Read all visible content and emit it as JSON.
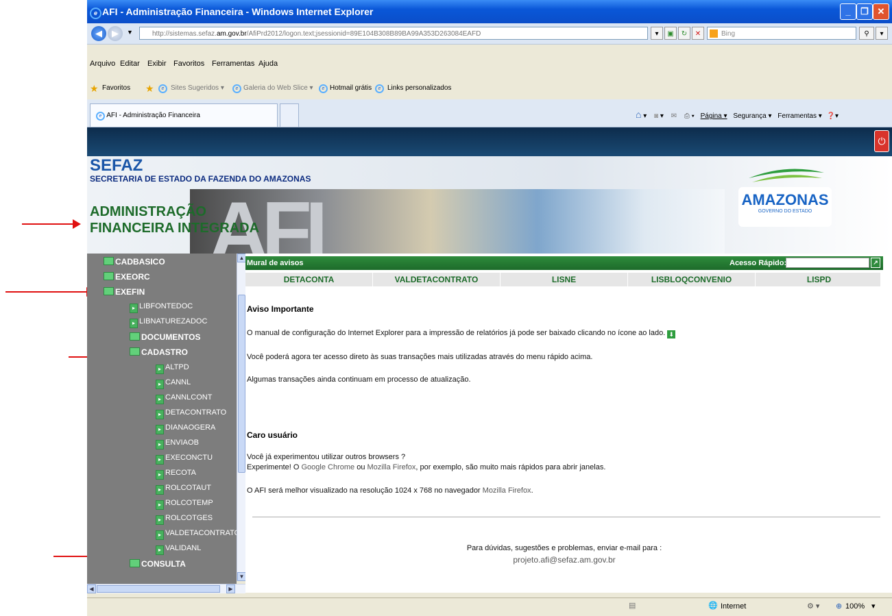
{
  "browser": {
    "title": "AFI - Administração Financeira - Windows Internet Explorer",
    "url_prefix": "http://sistemas.sefaz.",
    "url_domain": "am.gov.br",
    "url_path": "/AfiPrd2012/logon.text;jsessionid=89E104B308B89BA99A353D263084EAFD",
    "search_placeholder": "Bing",
    "menu": [
      "Arquivo",
      "Editar",
      "Exibir",
      "Favoritos",
      "Ferramentas",
      "Ajuda"
    ],
    "favorites_label": "Favoritos",
    "favorites": [
      "Sites Sugeridos ▾",
      "Galeria do Web Slice ▾",
      "Hotmail grátis",
      "Links personalizados"
    ],
    "tab_label": "AFI - Administração Financeira",
    "commands": [
      "Página ▾",
      "Segurança ▾",
      "Ferramentas ▾"
    ],
    "status_zone": "Internet",
    "zoom": "100%"
  },
  "banner": {
    "sefaz": "SEFAZ",
    "sefaz_sub": "SECRETARIA DE ESTADO DA FAZENDA DO AMAZONAS",
    "adm_line1": "ADMINISTRAÇÃO",
    "adm_line2": "FINANCEIRA INTEGRADA",
    "logo_main": "AMAZONAS",
    "logo_sub": "GOVERNO DO ESTADO"
  },
  "sidebar": {
    "items": [
      {
        "label": "CADBASICO"
      },
      {
        "label": "EXEORC"
      },
      {
        "label": "EXEFIN"
      },
      {
        "label": "LIBFONTEDOC"
      },
      {
        "label": "LIBNATUREZADOC"
      },
      {
        "label": "DOCUMENTOS"
      },
      {
        "label": "CADASTRO"
      },
      {
        "label": "ALTPD"
      },
      {
        "label": "CANNL"
      },
      {
        "label": "CANNLCONT"
      },
      {
        "label": "DETACONTRATO"
      },
      {
        "label": "DIANAOGERA"
      },
      {
        "label": "ENVIAOB"
      },
      {
        "label": "EXECONCTU"
      },
      {
        "label": "RECOTA"
      },
      {
        "label": "ROLCOTAUT"
      },
      {
        "label": "ROLCOTEMP"
      },
      {
        "label": "ROLCOTGES"
      },
      {
        "label": "VALDETACONTRATO"
      },
      {
        "label": "VALIDANL"
      },
      {
        "label": "CONSULTA"
      }
    ]
  },
  "main": {
    "mural_label": "Mural de avisos",
    "acesso_label": "Acesso Rápido:",
    "quick_links": [
      "DETACONTA",
      "VALDETACONTRATO",
      "LISNE",
      "LISBLOQCONVENIO",
      "LISPD"
    ],
    "aviso_title": "Aviso Importante",
    "aviso_p1": "O manual de configuração do Internet Explorer para a impressão de relatórios já pode ser baixado clicando no ícone ao lado.",
    "aviso_p2": "Você poderá agora ter acesso direto às suas transações mais utilizadas através do menu rápido acima.",
    "aviso_p3": "Algumas transações ainda continuam em processo de atualização.",
    "caro_title": "Caro usuário",
    "caro_p1": "Você já experimentou utilizar outros browsers ?",
    "caro_p2_a": "Experimente! O ",
    "chrome": "Google Chrome",
    "caro_p2_b": " ou ",
    "firefox": "Mozilla Firefox",
    "caro_p2_c": ", por exemplo, são muito mais rápidos para abrir janelas.",
    "res_a": "O AFI será melhor visualizado na resolução 1024 x 768 no navegador ",
    "res_link": "Mozilla Firefox",
    "res_b": ".",
    "footer_line1": "Para dúvidas, sugestões e problemas, enviar e-mail para :",
    "footer_email": "projeto.afi@sefaz.am.gov.br"
  },
  "colors": {
    "accent_green": "#1d6b2a",
    "sidebar_gray": "#7d7d7d",
    "header_navy": "#0d2c4c",
    "annotation_red": "#e01010"
  }
}
